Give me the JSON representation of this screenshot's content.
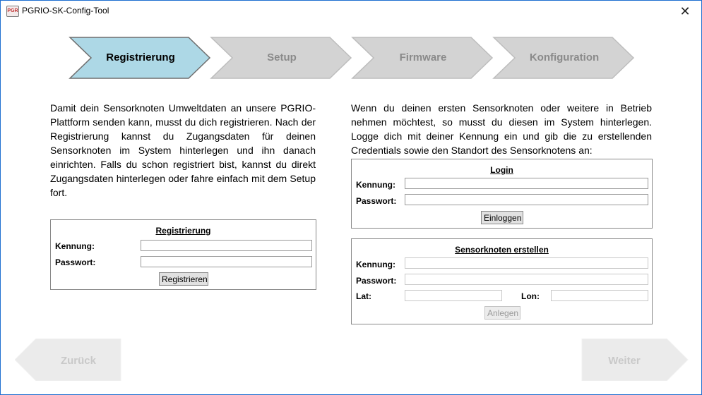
{
  "window": {
    "title": "PGRIO-SK-Config-Tool",
    "icon_text": "PGR"
  },
  "steps": [
    {
      "label": "Registrierung",
      "active": true
    },
    {
      "label": "Setup",
      "active": false
    },
    {
      "label": "Firmware",
      "active": false
    },
    {
      "label": "Konfiguration",
      "active": false
    }
  ],
  "left": {
    "description": "Damit dein Sensorknoten Umweltdaten an unsere PGRIO-Plattform senden kann, musst du dich registrieren. Nach der Registrierung kannst du Zugangsdaten für deinen Sensorknoten im System hinterlegen und ihn danach einrichten. Falls du schon registriert bist, kannst du direkt Zugangsdaten hinterlegen oder fahre einfach mit dem Setup fort.",
    "panel": {
      "title": "Registrierung",
      "kennung_label": "Kennung:",
      "kennung_value": "",
      "passwort_label": "Passwort:",
      "passwort_value": "",
      "button": "Registrieren"
    }
  },
  "right": {
    "description": "Wenn du deinen ersten Sensorknoten oder weitere in Betrieb nehmen möchtest, so musst du diesen im System hinterlegen. Logge dich mit deiner Kennung ein und gib die zu erstellenden Credentials sowie den Standort des Sensorknotens an:",
    "login": {
      "title": "Login",
      "kennung_label": "Kennung:",
      "kennung_value": "",
      "passwort_label": "Passwort:",
      "passwort_value": "",
      "button": "Einloggen"
    },
    "create": {
      "title": "Sensorknoten erstellen",
      "kennung_label": "Kennung:",
      "kennung_value": "",
      "passwort_label": "Passwort:",
      "passwort_value": "",
      "lat_label": "Lat:",
      "lat_value": "",
      "lon_label": "Lon:",
      "lon_value": "",
      "button": "Anlegen"
    }
  },
  "nav": {
    "back": "Zurück",
    "next": "Weiter"
  },
  "colors": {
    "active_step": "#add8e6",
    "inactive_step": "#d3d3d3",
    "disabled_nav": "#ebebeb",
    "window_border": "#1e6fd0"
  }
}
